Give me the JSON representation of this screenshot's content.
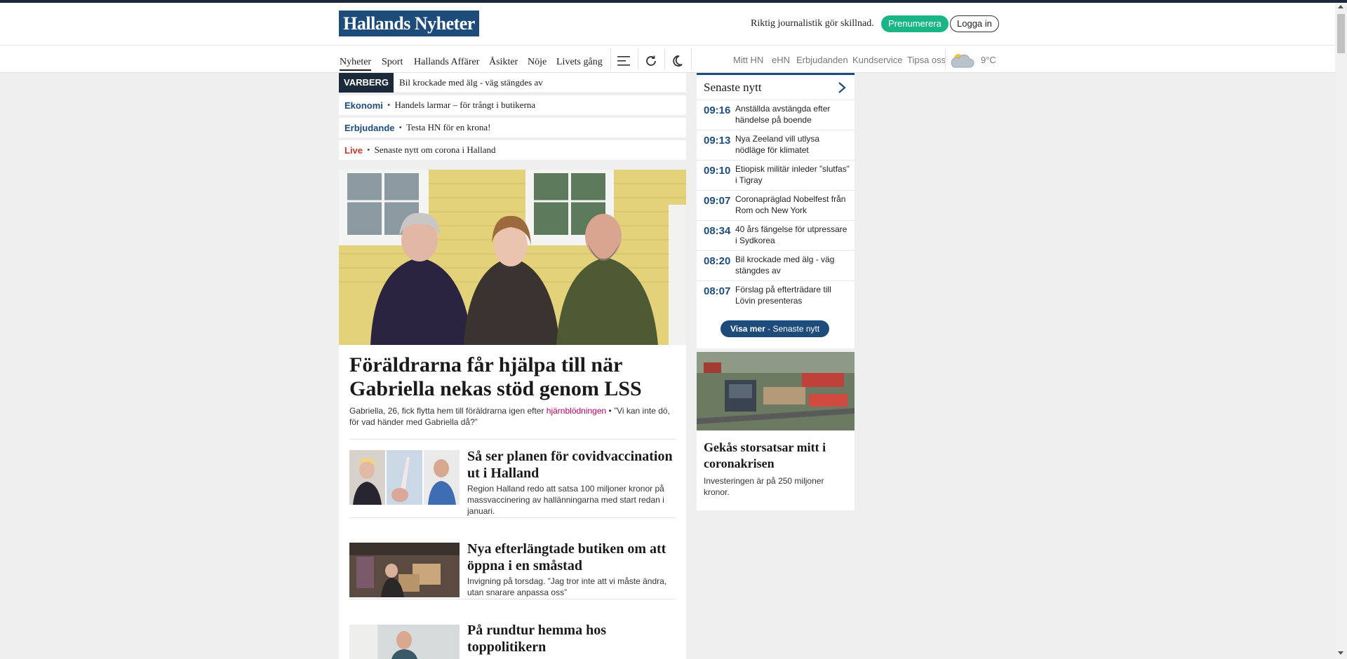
{
  "header": {
    "logo": "Hallands Nyheter",
    "tagline": "Riktig journalistik gör skillnad.",
    "subscribe": "Prenumerera",
    "login": "Logga in"
  },
  "nav": {
    "items": [
      "Nyheter",
      "Sport",
      "Hallands Affärer",
      "Åsikter",
      "Nöje",
      "Livets gång"
    ],
    "right": [
      "Mitt HN",
      "eHN",
      "Erbjudanden",
      "Kundservice",
      "Tipsa oss"
    ],
    "temperature": "9°C"
  },
  "teasers": {
    "breaking_tag": "VARBERG",
    "breaking_text": "Bil krockade med älg - väg stängdes av",
    "rows": [
      {
        "kicker": "Ekonomi",
        "text": "Handels larmar – för trångt i butikerna"
      },
      {
        "kicker": "Erbjudande",
        "text": "Testa HN för en krona!"
      },
      {
        "kicker": "Live",
        "text": "Senaste nytt om corona i Halland"
      }
    ]
  },
  "hero": {
    "title": "Föräldrarna får hjälpa till när Gabriella nekas stöd genom LSS",
    "lead_pre": "Gabriella, 26, fick flytta hem till föräldrarna igen efter ",
    "lead_highlight": "hjärnblödningen",
    "lead_post": " • ”Vi kan inte dö, för vad händer med Gabriella då?”"
  },
  "stories": [
    {
      "title": "Så ser planen för covidvaccination ut i Halland",
      "lead": "Region Halland redo att satsa 100 miljoner kronor på massvaccinering av hallänningarna med start redan i januari."
    },
    {
      "title": "Nya efterlängtade butiken om att öppna i en småstad",
      "lead": "Invigning på torsdag. ”Jag tror inte att vi måste ändra, utan snarare anpassa oss”"
    },
    {
      "title": "På rundtur hemma hos toppolitikern",
      "lead": ""
    }
  ],
  "latest": {
    "heading": "Senaste nytt",
    "items": [
      {
        "time": "09:16",
        "text": "Anställda avstängda efter händelse på boende"
      },
      {
        "time": "09:13",
        "text": "Nya Zeeland vill utlysa nödläge för klimatet"
      },
      {
        "time": "09:10",
        "text": "Etiopisk militär inleder ”slutfas” i Tigray"
      },
      {
        "time": "09:07",
        "text": "Coronapräglad Nobelfest från Rom och New York"
      },
      {
        "time": "08:34",
        "text": "40 års fängelse för utpressare i Sydkorea"
      },
      {
        "time": "08:20",
        "text": "Bil krockade med älg - väg stängdes av"
      },
      {
        "time": "08:07",
        "text": "Förslag på efterträdare till Lövin presenteras"
      }
    ],
    "more_bold": "Visa mer",
    "more_rest": " - Senaste nytt"
  },
  "promo": {
    "title": "Gekås storsatsar mitt i coronakrisen",
    "lead": "Investeringen är på 250 miljoner kronor."
  },
  "colors": {
    "brand": "#1d4c7a",
    "subscribe": "#1ab585",
    "breaking_tag": "#1a2a3a",
    "live": "#c0392b"
  }
}
